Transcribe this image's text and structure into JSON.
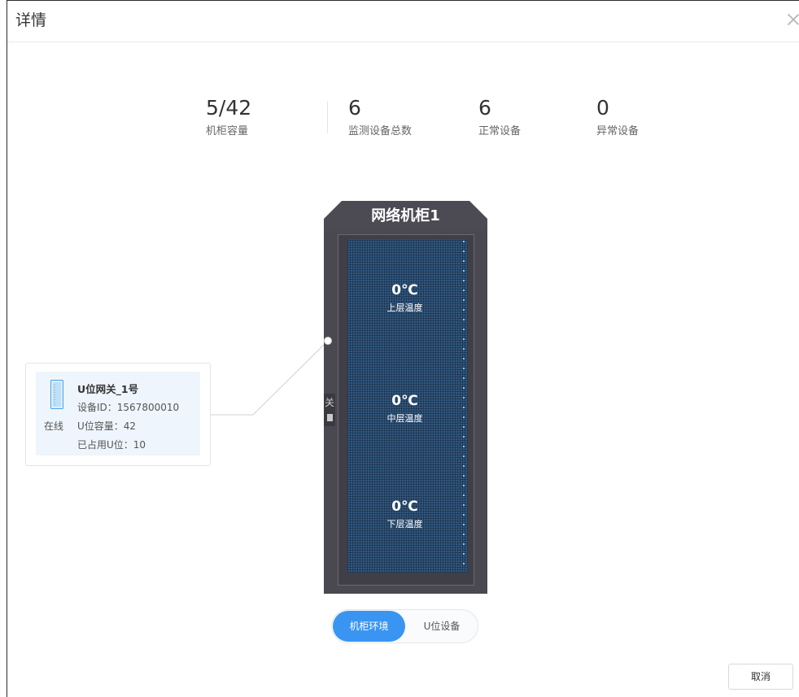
{
  "dialog": {
    "title": "详情"
  },
  "stats": [
    {
      "value": "5/42",
      "label": "机柜容量"
    },
    {
      "value": "6",
      "label": "监测设备总数"
    },
    {
      "value": "6",
      "label": "正常设备"
    },
    {
      "value": "0",
      "label": "异常设备"
    }
  ],
  "cabinet": {
    "name": "网络机柜1",
    "side_label": "关",
    "temps": [
      {
        "value": "0℃",
        "label": "上层温度"
      },
      {
        "value": "0℃",
        "label": "中层温度"
      },
      {
        "value": "0℃",
        "label": "下层温度"
      }
    ]
  },
  "gateway": {
    "name": "U位网关_1号",
    "status": "在线",
    "device_id": "设备ID：1567800010",
    "capacity": "U位容量：42",
    "used": "已占用U位：10"
  },
  "tabs": {
    "active": "机柜环境",
    "inactive": "U位设备"
  },
  "footer": {
    "cancel": "取消"
  },
  "colors": {
    "accent": "#3a95f2",
    "cabinet": "#4a4850",
    "rack_grid": "#33587c"
  }
}
